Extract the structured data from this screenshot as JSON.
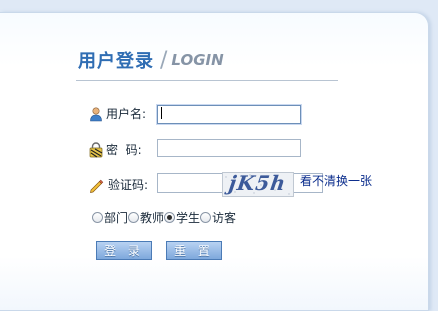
{
  "header": {
    "title_cn": "用户登录",
    "separator": "/",
    "title_en": "LOGIN"
  },
  "form": {
    "username": {
      "label": "用户名:",
      "value": "",
      "icon": "user-icon"
    },
    "password": {
      "label": "密  码:",
      "value": "",
      "icon": "lock-icon"
    },
    "captcha": {
      "label": "验证码:",
      "value": "",
      "icon": "pencil-icon",
      "image_text": "jK5h",
      "refresh_label": "看不清换一张"
    }
  },
  "roles": {
    "options": [
      "部门",
      "教师",
      "学生",
      "访客"
    ],
    "selected": "学生"
  },
  "buttons": {
    "login": "登 录",
    "reset": "重 置"
  },
  "colors": {
    "accent": "#2f6db3",
    "button": "#7ea8dc",
    "link": "#0a2c8c"
  }
}
